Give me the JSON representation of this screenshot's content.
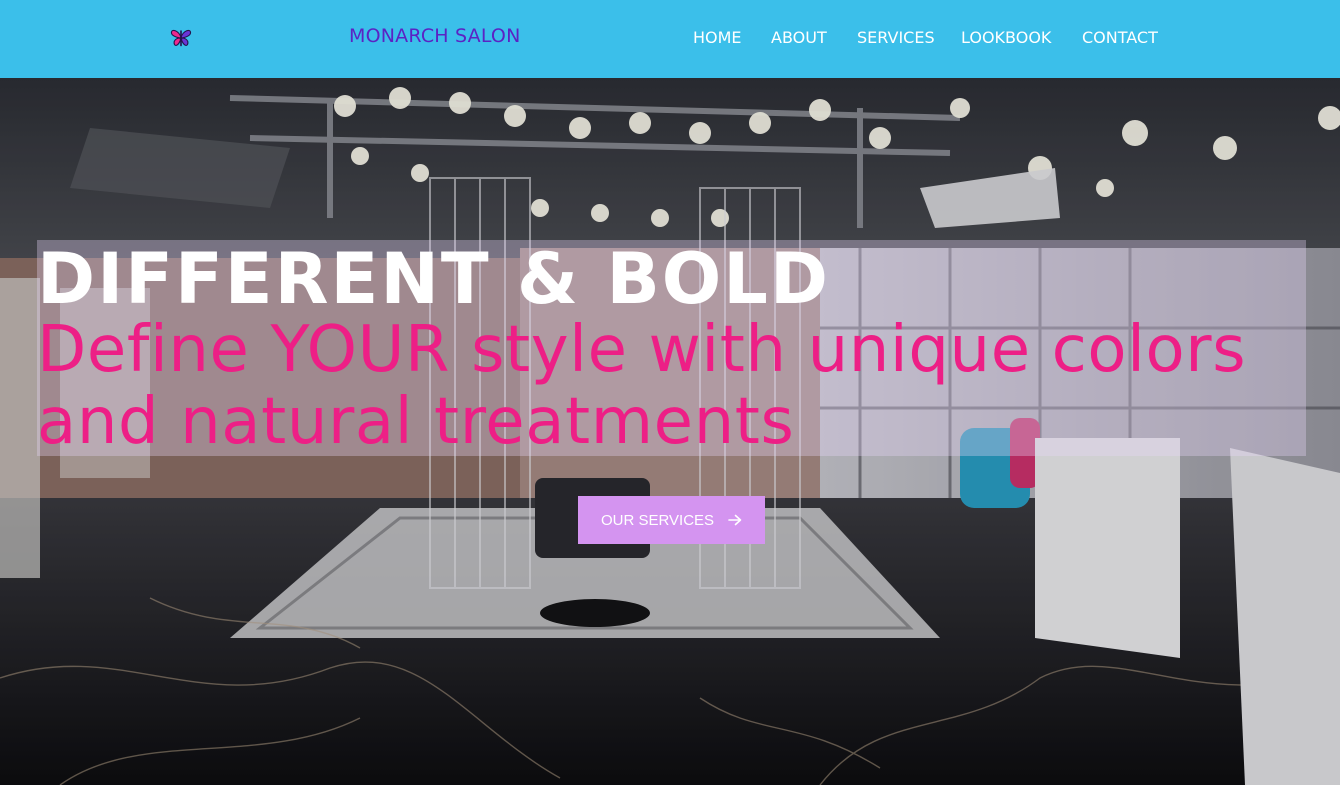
{
  "header": {
    "brand": "MONARCH SALON",
    "logo_icon": "butterfly-icon",
    "background_color": "#3bbfea",
    "brand_color": "#5b23c4"
  },
  "nav": {
    "items": [
      {
        "label": "HOME"
      },
      {
        "label": "ABOUT"
      },
      {
        "label": "SERVICES"
      },
      {
        "label": "LOOKBOOK"
      },
      {
        "label": "CONTACT"
      }
    ]
  },
  "hero": {
    "background_image": "salon-interior-photo",
    "title": "DIFFERENT & BOLD",
    "subtitle": "Define YOUR style with unique colors and natural treatments",
    "subtitle_color": "#ed1f86",
    "cta": {
      "label": "OUR SERVICES",
      "icon": "arrow-right-icon",
      "background_color": "#d494f0"
    }
  }
}
